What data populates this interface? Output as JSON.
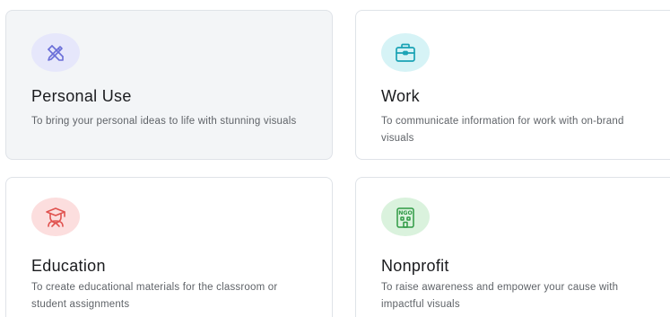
{
  "cards": [
    {
      "title": "Personal Use",
      "description": "To bring your personal ideas to life with stunning visuals",
      "icon": "pen-brush-icon",
      "icon_bg": "#e6e7fb",
      "icon_color": "#6b6fd8",
      "selected": true
    },
    {
      "title": "Work",
      "description": "To communicate information for work with on-brand visuals",
      "icon": "briefcase-icon",
      "icon_bg": "#d6f3f6",
      "icon_color": "#1aa3b5",
      "selected": false
    },
    {
      "title": "Education",
      "description": "To create educational materials for the classroom or student assignments",
      "icon": "graduate-icon",
      "icon_bg": "#fcdede",
      "icon_color": "#e0524f",
      "selected": false
    },
    {
      "title": "Nonprofit",
      "description": "To raise awareness and empower your cause with impactful visuals",
      "icon": "ngo-building-icon",
      "icon_bg": "#daf2dd",
      "icon_color": "#2f9a45",
      "icon_text": "NGO",
      "selected": false
    }
  ]
}
